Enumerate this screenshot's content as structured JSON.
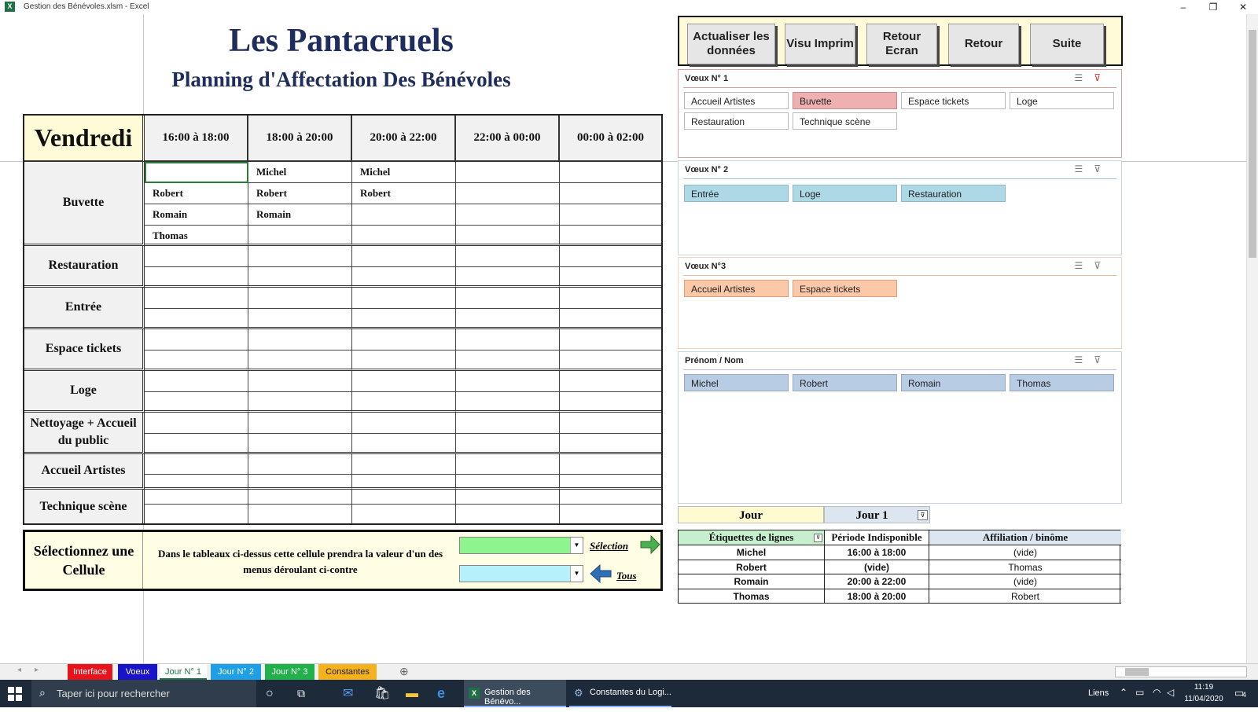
{
  "window": {
    "title": "Gestion des Bénévoles.xlsm - Excel",
    "app_icon": "excel-icon"
  },
  "sheet": {
    "title": "Les Pantacruels",
    "subtitle": "Planning d'Affectation Des Bénévoles",
    "day": "Vendredi",
    "timeslots": [
      "16:00 à 18:00",
      "18:00 à 20:00",
      "20:00 à 22:00",
      "22:00 à 00:00",
      "00:00 à 02:00"
    ],
    "posts": [
      "Buvette",
      "Restauration",
      "Entrée",
      "Espace tickets",
      "Loge",
      "Nettoyage + Accueil du public",
      "Accueil Artistes",
      "Technique scène"
    ],
    "buvette_cells": [
      [
        "",
        "Michel",
        "Michel",
        "",
        ""
      ],
      [
        "Robert",
        "Robert",
        "Robert",
        "",
        ""
      ],
      [
        "Romain",
        "Romain",
        "",
        "",
        ""
      ],
      [
        "Thomas",
        "",
        "",
        "",
        ""
      ]
    ],
    "select_panel": {
      "title": "Sélectionnez une Cellule",
      "text": "Dans le tableaux ci-dessus cette cellule prendra la valeur d'un des menus déroulant ci-contre",
      "selection_link": "Sélection",
      "tous_link": "Tous"
    }
  },
  "buttons": [
    {
      "label": "Actualiser les données"
    },
    {
      "label": "Visu Imprim"
    },
    {
      "label": "Retour Ecran"
    },
    {
      "label": "Retour"
    },
    {
      "label": "Suite"
    }
  ],
  "slicers": [
    {
      "title": "Vœux N° 1",
      "items": [
        "Accueil Artistes",
        "Buvette",
        "Espace tickets",
        "Loge",
        "Restauration",
        "Technique scène"
      ],
      "selected": "Buvette"
    },
    {
      "title": "Vœux N° 2",
      "items": [
        "Entrée",
        "Loge",
        "Restauration"
      ]
    },
    {
      "title": "Vœux N°3",
      "items": [
        "Accueil Artistes",
        "Espace tickets"
      ]
    },
    {
      "title": "Prénom / Nom",
      "items": [
        "Michel",
        "Robert",
        "Romain",
        "Thomas"
      ]
    }
  ],
  "pivot": {
    "filter_label": "Jour",
    "filter_value": "Jour 1",
    "headers": [
      "Étiquettes de lignes",
      "Période Indisponible",
      "Affiliation / binôme"
    ],
    "rows": [
      [
        "Michel",
        "16:00 à 18:00",
        "(vide)"
      ],
      [
        "Robert",
        "(vide)",
        "Thomas"
      ],
      [
        "Romain",
        "20:00 à 22:00",
        "(vide)"
      ],
      [
        "Thomas",
        "18:00 à 20:00",
        "Robert"
      ]
    ]
  },
  "sheet_tabs": [
    {
      "label": "Interface",
      "color": "#e8141c"
    },
    {
      "label": "Voeux",
      "color": "#1a14c8"
    },
    {
      "label": "Jour N° 1",
      "color": "#ffffff"
    },
    {
      "label": "Jour N° 2",
      "color": "#1ea0e6"
    },
    {
      "label": "Jour N° 3",
      "color": "#22b04a"
    },
    {
      "label": "Constantes",
      "color": "#f5b21c"
    }
  ],
  "taskbar": {
    "search_placeholder": "Taper ici pour rechercher",
    "app1": "Gestion des Bénévo...",
    "app2": "Constantes du Logi...",
    "links": "Liens",
    "time": "11:19",
    "date": "11/04/2020",
    "notif_count": "4"
  }
}
